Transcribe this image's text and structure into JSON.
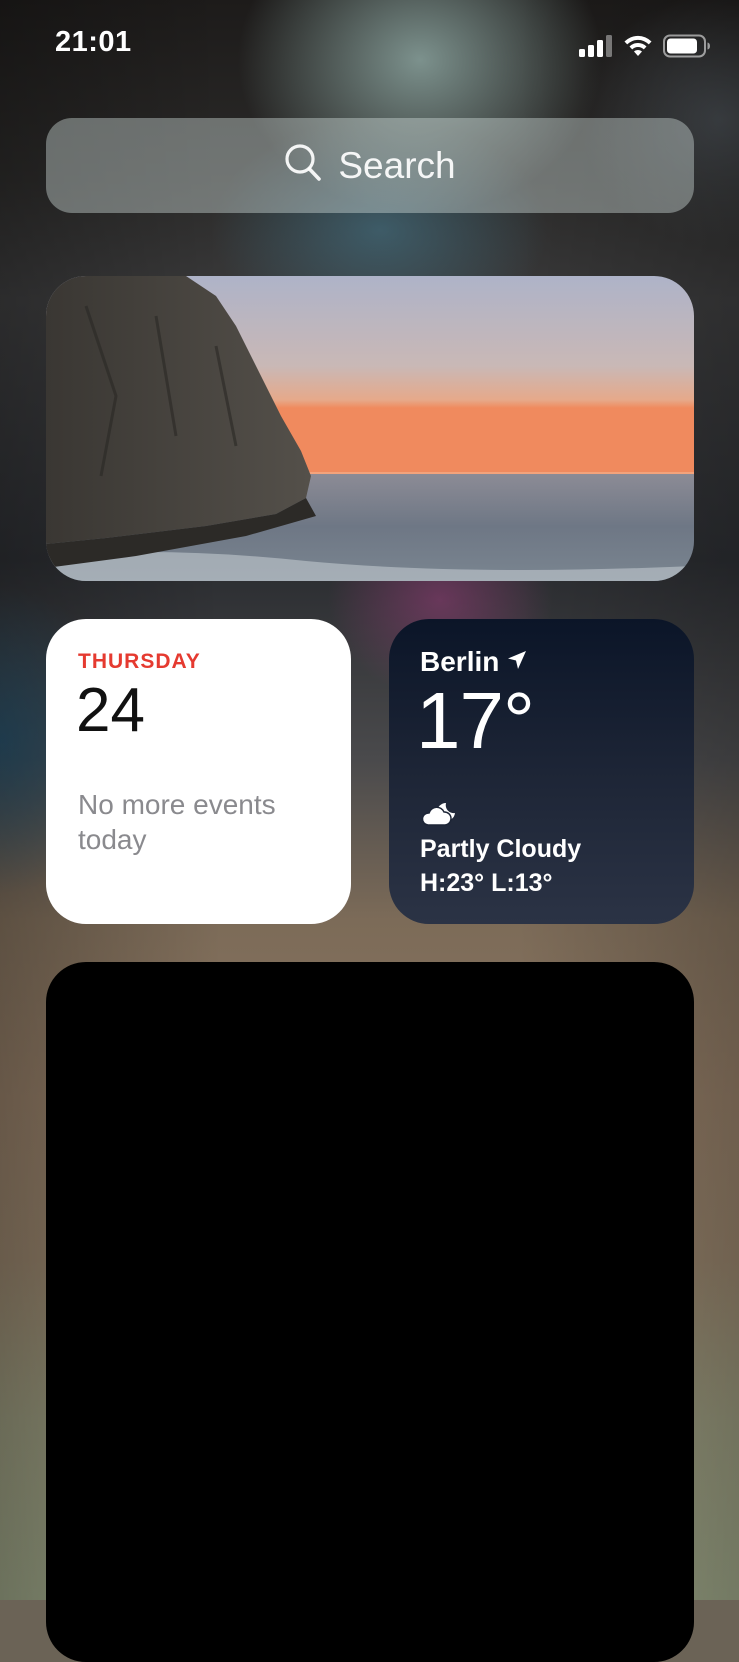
{
  "status_bar": {
    "time": "21:01",
    "icons": [
      "cellular-signal-icon",
      "wifi-icon",
      "battery-icon"
    ]
  },
  "search": {
    "placeholder": "Search",
    "icon": "search-icon"
  },
  "photo_widget": {
    "subject": "sunset-over-sea-with-cliff"
  },
  "calendar_widget": {
    "day": "THURSDAY",
    "date": "24",
    "note": "No more events today",
    "accent_color": "#e53a30"
  },
  "weather_widget": {
    "city": "Berlin",
    "location_icon": "location-arrow-icon",
    "temperature": "17°",
    "condition_icon": "partly-cloudy-night-icon",
    "condition": "Partly Cloudy",
    "high_low": "H:23° L:13°"
  },
  "large_widget": {
    "color": "#000000"
  }
}
